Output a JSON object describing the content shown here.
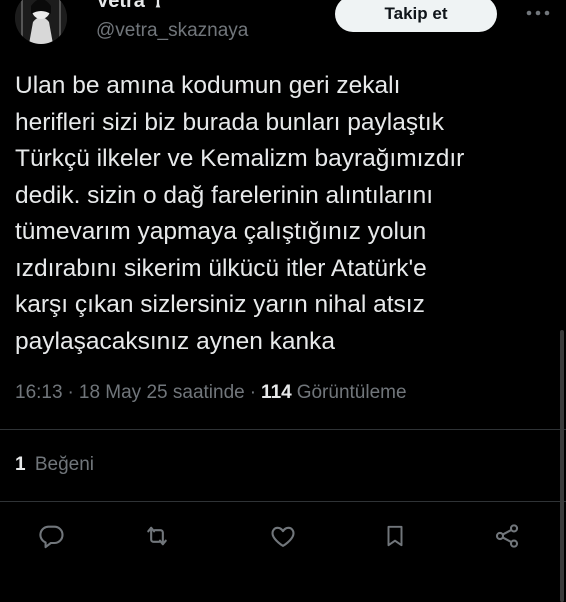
{
  "author": {
    "display_name": "Vetra ☥",
    "handle": "@vetra_skaznaya"
  },
  "follow_button": {
    "label": "Takip et"
  },
  "tweet": {
    "text": "Ulan be amına kodumun geri zekalı\nherifleri sizi biz burada bunları paylaştık\nTürkçü ilkeler ve Kemalizm bayrağımızdır\ndedik. sizin o dağ farelerinin alıntılarını\ntümevarım yapmaya çalıştığınız yolun\nızdırabını sikerim ülkücü itler Atatürk'e\nkarşı çıkan sizlersiniz yarın nihal atsız\npaylaşacaksınız aynen kanka"
  },
  "meta": {
    "time": "16:13",
    "sep1": "·",
    "date": "18 May 25 saatinde",
    "sep2": "·",
    "views_count": "114",
    "views_label": "Görüntüleme"
  },
  "engagement": {
    "likes_count": "1",
    "likes_label": "Beğeni"
  },
  "actions": [
    {
      "icon": "reply-icon"
    },
    {
      "icon": "repost-icon"
    },
    {
      "icon": "like-icon"
    },
    {
      "icon": "bookmark-icon"
    },
    {
      "icon": "share-icon"
    }
  ],
  "colors": {
    "background": "#000000",
    "text_primary": "#e7e9ea",
    "text_secondary": "#71767b",
    "divider": "#2f3336",
    "button_bg": "#eff3f4",
    "button_text": "#0f1419"
  }
}
